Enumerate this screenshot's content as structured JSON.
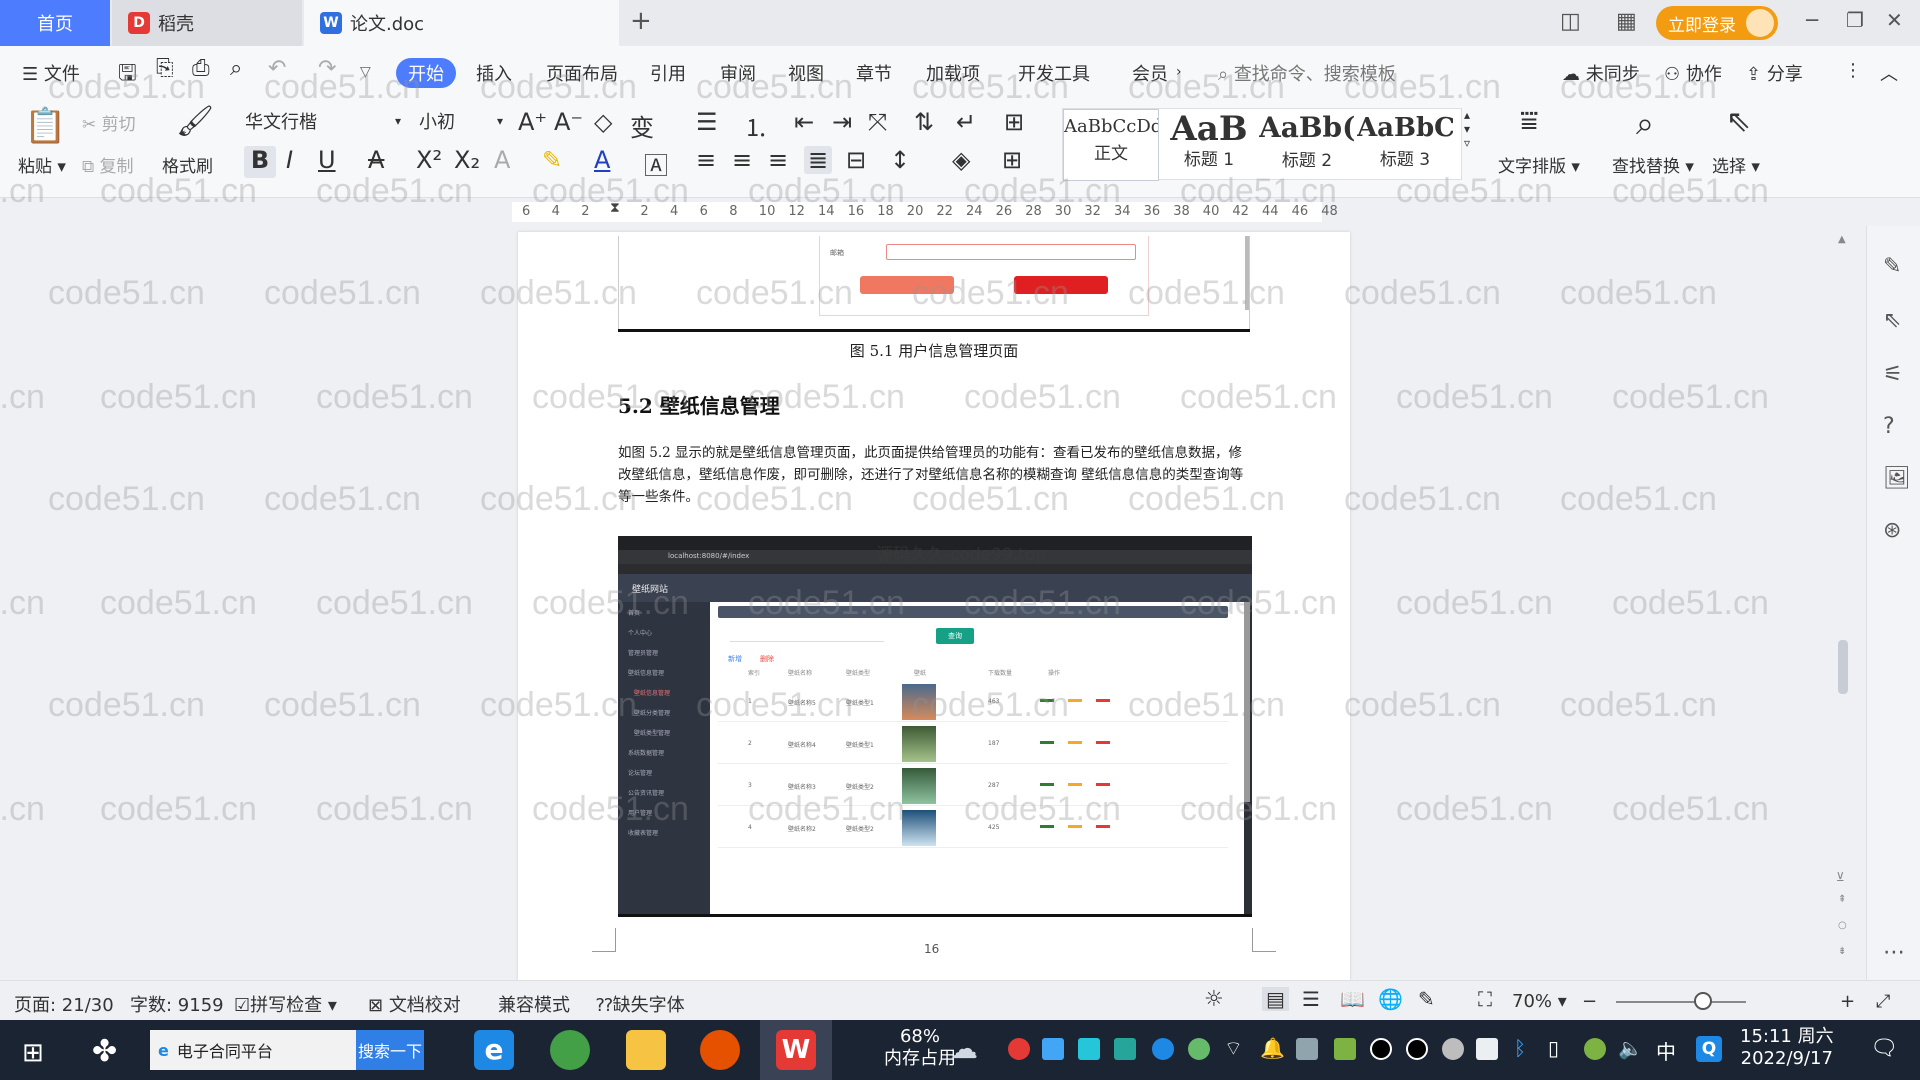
{
  "tabs": {
    "home": "首页",
    "docer": "稻壳",
    "doc": "论文.doc"
  },
  "topbar": {
    "login": "立即登录"
  },
  "menu": {
    "file": "文件",
    "items": [
      "开始",
      "插入",
      "页面布局",
      "引用",
      "审阅",
      "视图",
      "章节",
      "加载项",
      "开发工具",
      "会员"
    ],
    "search_cmd": "查找命令、搜索模板",
    "unsynced": "未同步",
    "collab": "协作",
    "share": "分享"
  },
  "ribbon": {
    "paste": "粘贴",
    "cut": "剪切",
    "copy": "复制",
    "format_painter": "格式刷",
    "font": "华文行楷",
    "size": "小初",
    "styles": [
      {
        "sample": "AaBbCcDd",
        "name": "正文"
      },
      {
        "sample": "AaB",
        "name": "标题 1"
      },
      {
        "sample": "AaBb(",
        "name": "标题 2"
      },
      {
        "sample": "AaBbC",
        "name": "标题 3"
      }
    ],
    "text_layout": "文字排版",
    "find_replace": "查找替换",
    "select": "选择"
  },
  "ruler": {
    "ticks": [
      "6",
      "4",
      "2",
      "",
      "2",
      "4",
      "6",
      "8",
      "10",
      "12",
      "14",
      "16",
      "18",
      "20",
      "22",
      "24",
      "26",
      "28",
      "30",
      "32",
      "34",
      "36",
      "38",
      "40",
      "42",
      "44",
      "46",
      "48"
    ]
  },
  "document": {
    "caption": "图 5.1  用户信息管理页面",
    "heading": "5.2  壁纸信息管理",
    "paragraph": "如图 5.2 显示的就是壁纸信息管理页面，此页面提供给管理员的功能有：查看已发布的壁纸信息数据，修改壁纸信息，壁纸信息作废，即可删除，还进行了对壁纸信息名称的模糊查询 壁纸信息信息的类型查询等等一些条件。",
    "overlay_text": "源码久久-code99.top",
    "page_number": "16",
    "watermark": "code51.cn",
    "figure": {
      "url": "localhost:8080/#/index",
      "app_title": "壁纸网站",
      "sidebar": [
        "首页",
        "个人中心",
        "管理员管理",
        "壁纸信息管理",
        "壁纸信息管理",
        "壁纸分类管理",
        "壁纸类型管理",
        "系统数据管理",
        "论坛管理",
        "公告资讯管理",
        "用户管理",
        "收藏表管理"
      ],
      "columns": [
        "索引",
        "壁纸名称",
        "壁纸类型",
        "壁纸",
        "下载数量",
        "操作"
      ],
      "rows": [
        {
          "idx": "1",
          "name": "壁纸名称5",
          "type": "壁纸类型1",
          "count": "463"
        },
        {
          "idx": "2",
          "name": "壁纸名称4",
          "type": "壁纸类型1",
          "count": "187"
        },
        {
          "idx": "3",
          "name": "壁纸名称3",
          "type": "壁纸类型2",
          "count": "287"
        },
        {
          "idx": "4",
          "name": "壁纸名称2",
          "type": "壁纸类型2",
          "count": "425"
        }
      ],
      "btn_search": "查询",
      "btn_add": "新增",
      "btn_delete": "删除"
    }
  },
  "status": {
    "page": "页面: 21/30",
    "words": "字数: 9159",
    "spell": "拼写检查",
    "proof": "文档校对",
    "compat": "兼容模式",
    "missing_font": "缺失字体",
    "zoom": "70%"
  },
  "taskbar": {
    "search_text": "电子合同平台",
    "search_btn": "搜索一下",
    "mem_pct": "68%",
    "mem_label": "内存占用",
    "ime": "中",
    "time": "15:11 周六",
    "date": "2022/9/17"
  },
  "colors": {
    "accent": "#4d7cfe",
    "login": "#f39c12",
    "taskbar": "#1b2433"
  }
}
